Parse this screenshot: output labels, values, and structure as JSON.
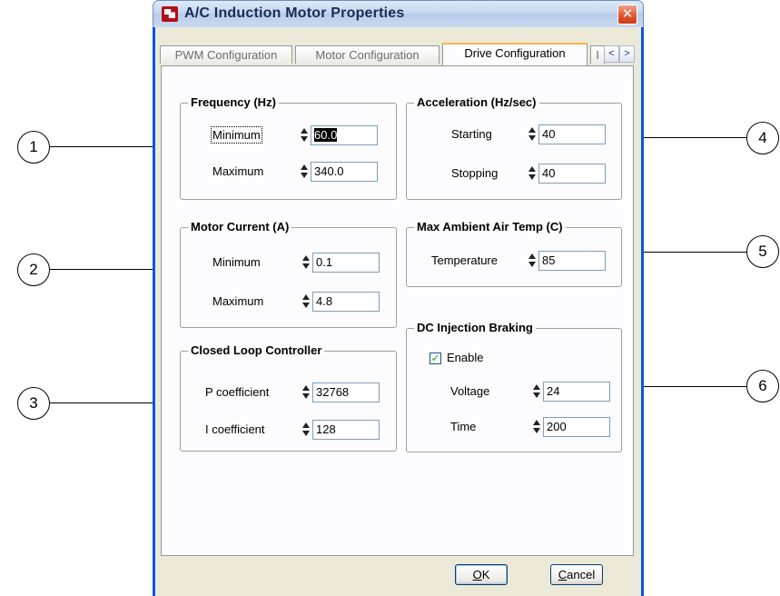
{
  "window": {
    "title": "A/C Induction Motor Properties",
    "close_glyph": "✕"
  },
  "tabs": [
    {
      "label": "PWM Configuration",
      "active": false
    },
    {
      "label": "Motor Configuration",
      "active": false
    },
    {
      "label": "Drive Configuration",
      "active": true
    },
    {
      "label": "I",
      "active": false
    }
  ],
  "tab_scroll": {
    "left": "<",
    "right": ">"
  },
  "groups": {
    "frequency": {
      "title": "Frequency (Hz)",
      "minimum_label": "Minimum",
      "minimum_value": "60.0",
      "maximum_label": "Maximum",
      "maximum_value": "340.0"
    },
    "acceleration": {
      "title": "Acceleration (Hz/sec)",
      "starting_label": "Starting",
      "starting_value": "40",
      "stopping_label": "Stopping",
      "stopping_value": "40"
    },
    "motor_current": {
      "title": "Motor Current (A)",
      "minimum_label": "Minimum",
      "minimum_value": "0.1",
      "maximum_label": "Maximum",
      "maximum_value": "4.8"
    },
    "max_ambient": {
      "title": "Max Ambient Air Temp (C)",
      "temperature_label": "Temperature",
      "temperature_value": "85"
    },
    "closed_loop": {
      "title": "Closed Loop Controller",
      "p_label": "P coefficient",
      "p_value": "32768",
      "i_label": "I coefficient",
      "i_value": "128"
    },
    "dc_injection": {
      "title": "DC Injection Braking",
      "enable_label": "Enable",
      "enable_checked": true,
      "check_glyph": "✓",
      "voltage_label": "Voltage",
      "voltage_value": "24",
      "time_label": "Time",
      "time_value": "200"
    }
  },
  "buttons": {
    "ok_mnemonic": "O",
    "ok_rest": "K",
    "cancel_mnemonic": "C",
    "cancel_rest": "ancel"
  },
  "callouts": [
    "1",
    "2",
    "3",
    "4",
    "5",
    "6"
  ],
  "colors": {
    "window_blue": "#0a54e2",
    "dialog_face": "#ece9d8",
    "close_red": "#e0592f",
    "active_tab_accent": "#f7b64c",
    "check_green": "#21a121"
  }
}
